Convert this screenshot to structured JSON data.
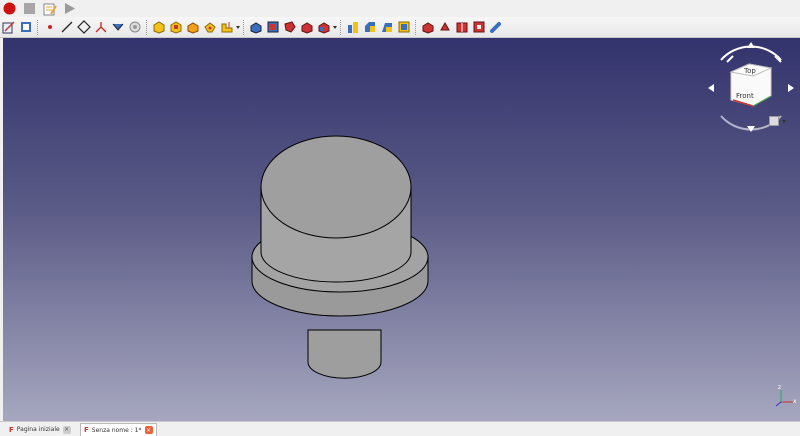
{
  "macro_toolbar": {
    "items": [
      {
        "icon": "record-macro-icon",
        "color": "#cc1111"
      },
      {
        "icon": "stop-macro-icon",
        "color": "#a6a6a6"
      },
      {
        "icon": "macro-editor-icon",
        "color": "#e8a33c"
      },
      {
        "icon": "execute-macro-icon",
        "color": "#9a9a9a"
      }
    ]
  },
  "main_toolbar": {
    "sketcher": [
      "sketch-icon",
      "point-icon",
      "line-icon",
      "polyline-icon",
      "fillet-icon",
      "constraint-icon",
      "trim-icon"
    ],
    "part_create": [
      "additive-solid-icon",
      "pad-icon",
      "revolve-icon",
      "loft-icon",
      "sweep-icon"
    ],
    "part_subtract": [
      "pocket-icon",
      "hole-icon",
      "groove-icon",
      "subtractive-loft-icon",
      "subtractive-sweep-icon"
    ],
    "dress_up": [
      "fillet-feature-icon",
      "chamfer-icon",
      "draft-icon",
      "thickness-icon"
    ],
    "transform": [
      "mirrored-icon",
      "linear-pattern-icon",
      "polar-pattern-icon",
      "multi-transform-icon",
      "boolean-icon"
    ]
  },
  "nav_cube": {
    "top_label": "Top",
    "front_label": "Front",
    "axis_x": "x",
    "axis_z": "z"
  },
  "tabs": [
    {
      "label": "Pagina iniziale",
      "active": false
    },
    {
      "label": "Senza nome : 1*",
      "active": true
    }
  ],
  "colors": {
    "bg_top": "#33336d",
    "bg_bottom": "#a6a7bf",
    "part_face": "#9a9a9a",
    "close_active": "#e8623a"
  }
}
